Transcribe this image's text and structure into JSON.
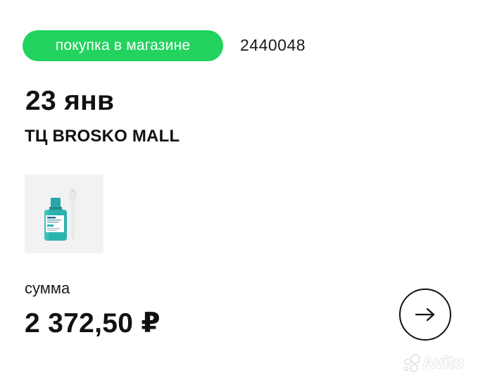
{
  "purchase": {
    "badge_label": "покупка в магазине",
    "order_number": "2440048",
    "date": "23 янв",
    "store": "ТЦ BROSKO MALL",
    "sum_label": "сумма",
    "sum_value": "2 372,50 ₽"
  },
  "product": {
    "image_alt": "product-photo",
    "label_text": "LA ROCHE-POSAY"
  },
  "watermark": {
    "text": "Avito"
  },
  "colors": {
    "badge": "#22d35e",
    "text": "#111111",
    "bottle": "#2bb3b0"
  },
  "icons": {
    "next": "arrow-right-icon",
    "watermark": "avito-dots-icon"
  }
}
